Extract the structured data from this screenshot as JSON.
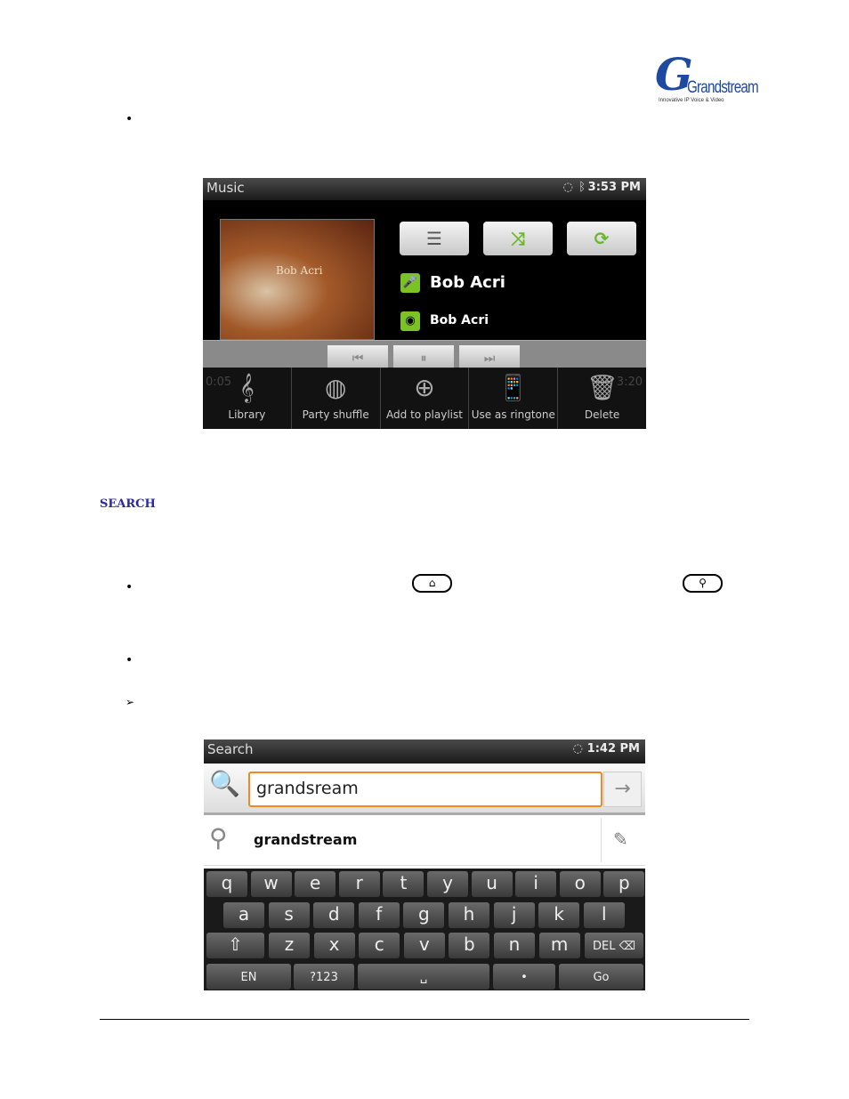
{
  "logo": {
    "text": "Grandstream",
    "tagline": "Innovative IP Voice & Video"
  },
  "bullets": [
    "•",
    "•",
    "•",
    "➢"
  ],
  "section_heading": "SEARCH",
  "hw_buttons": {
    "home": "home-icon",
    "search": "search-icon"
  },
  "music": {
    "status_title": "Music",
    "time": "3:53 PM",
    "album_text": "Bob Acri",
    "artist": "Bob Acri",
    "album": "Bob Acri",
    "buttons": [
      "list-icon",
      "shuffle-icon",
      "repeat-icon"
    ],
    "elapsed": "0:05",
    "duration": "3:20",
    "menu": [
      {
        "label": "Library",
        "icon": "library-icon"
      },
      {
        "label": "Party shuffle",
        "icon": "party-shuffle-icon"
      },
      {
        "label": "Add to playlist",
        "icon": "add-icon"
      },
      {
        "label": "Use as ringtone",
        "icon": "ringtone-icon"
      },
      {
        "label": "Delete",
        "icon": "delete-icon"
      }
    ],
    "colors": {
      "accent": "#7bc225"
    }
  },
  "search": {
    "status_title": "Search",
    "time": "1:42 PM",
    "query": "grandsream",
    "suggestion": "grandstream",
    "colors": {
      "focus": "#f08a1c"
    },
    "keyboard": {
      "row1": [
        "q",
        "w",
        "e",
        "r",
        "t",
        "y",
        "u",
        "i",
        "o",
        "p"
      ],
      "row2": [
        "a",
        "s",
        "d",
        "f",
        "g",
        "h",
        "j",
        "k",
        "l"
      ],
      "row3": [
        "⇧",
        "z",
        "x",
        "c",
        "v",
        "b",
        "n",
        "m",
        "DEL ⌫"
      ],
      "row4": [
        "EN",
        "?123",
        "␣",
        "•",
        "Go"
      ]
    }
  }
}
